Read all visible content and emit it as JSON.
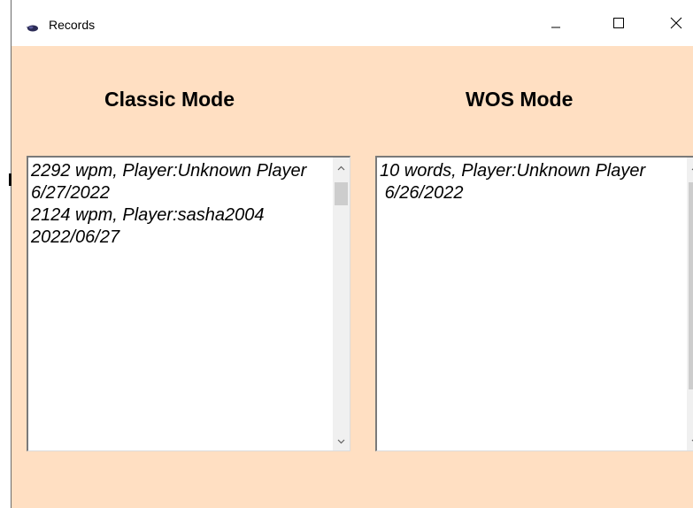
{
  "window": {
    "title": "Records",
    "icon": "app-icon",
    "controls": {
      "minimize": "minimize-icon",
      "maximize": "maximize-icon",
      "close": "close-icon"
    }
  },
  "classic": {
    "heading": "Classic Mode",
    "items": [
      "2292 wpm, Player:Unknown Player 6/27/2022",
      "2124 wpm, Player:sasha2004 2022/06/27"
    ]
  },
  "wos": {
    "heading": "WOS Mode",
    "items": [
      "10 words, Player:Unknown Player\n 6/26/2022"
    ]
  },
  "colors": {
    "background": "#ffdfc2",
    "titlebar": "#ffffff",
    "listbox": "#ffffff",
    "scrollbar_track": "#f0f0f0",
    "scrollbar_thumb": "#cdcdcd"
  }
}
